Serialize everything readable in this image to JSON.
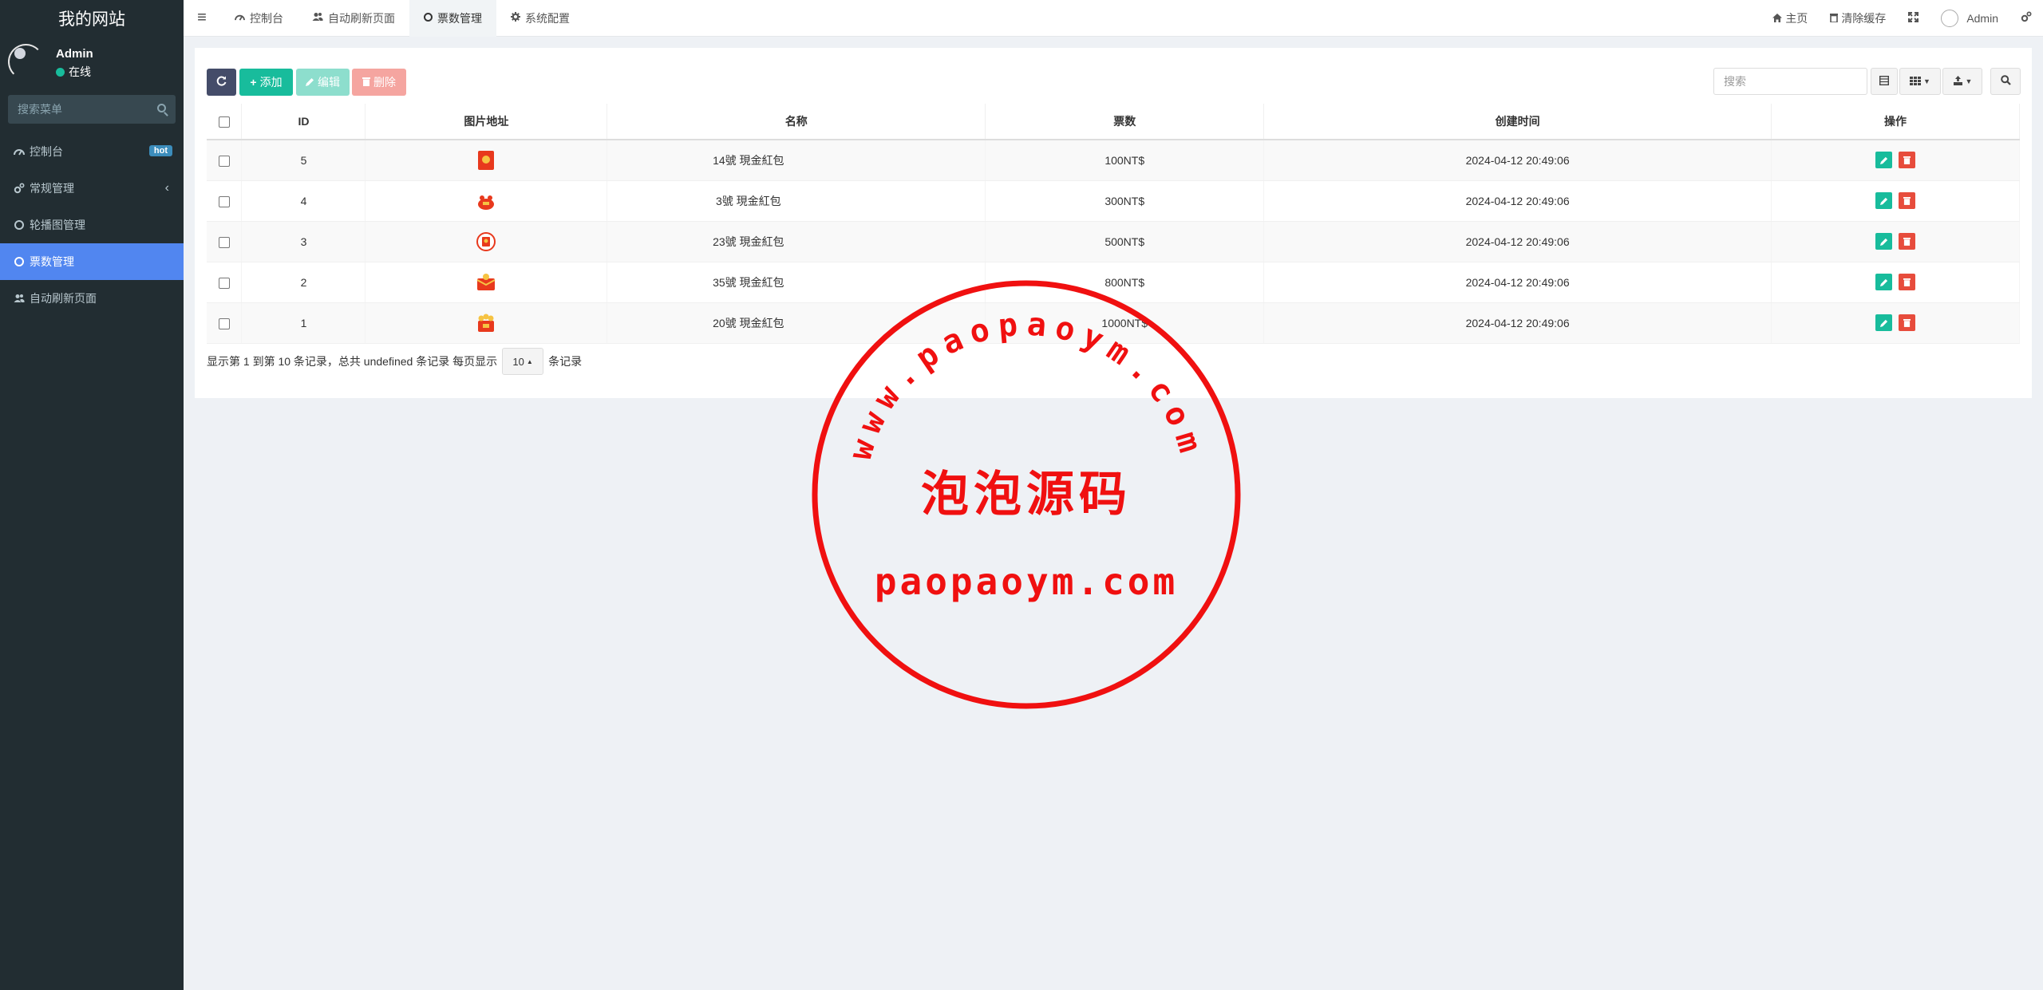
{
  "site": {
    "title": "我的网站"
  },
  "user": {
    "name": "Admin",
    "status": "在线"
  },
  "sidebar": {
    "search_placeholder": "搜索菜单",
    "items": [
      {
        "label": "控制台",
        "icon": "dashboard-icon",
        "badge": "hot"
      },
      {
        "label": "常规管理",
        "icon": "cogs-icon",
        "chevron": "‹"
      },
      {
        "label": "轮播图管理",
        "icon": "circle-icon"
      },
      {
        "label": "票数管理",
        "icon": "circle-icon",
        "active": true
      },
      {
        "label": "自动刷新页面",
        "icon": "users-icon"
      }
    ]
  },
  "header": {
    "menu_glyph": "≡",
    "tabs": [
      {
        "label": "控制台"
      },
      {
        "label": "自动刷新页面"
      },
      {
        "label": "票数管理",
        "active": true
      },
      {
        "label": "系统配置"
      }
    ],
    "right": {
      "home": "主页",
      "clear_cache": "清除缓存",
      "admin": "Admin"
    }
  },
  "toolbar": {
    "add_label": "添加",
    "edit_label": "编辑",
    "delete_label": "删除",
    "search_placeholder": "搜索"
  },
  "table": {
    "columns": [
      "ID",
      "图片地址",
      "名称",
      "票数",
      "创建时间",
      "操作"
    ],
    "rows": [
      {
        "id": "5",
        "name": "14號 現金紅包",
        "votes": "100NT$",
        "created": "2024-04-12 20:49:06"
      },
      {
        "id": "4",
        "name": "3號 現金紅包",
        "votes": "300NT$",
        "created": "2024-04-12 20:49:06"
      },
      {
        "id": "3",
        "name": "23號 現金紅包",
        "votes": "500NT$",
        "created": "2024-04-12 20:49:06"
      },
      {
        "id": "2",
        "name": "35號 現金紅包",
        "votes": "800NT$",
        "created": "2024-04-12 20:49:06"
      },
      {
        "id": "1",
        "name": "20號 現金紅包",
        "votes": "1000NT$",
        "created": "2024-04-12 20:49:06"
      }
    ]
  },
  "pager": {
    "summary": "显示第 1 到第 10 条记录，总共 undefined 条记录 每页显示",
    "page_size": "10",
    "suffix": "条记录"
  },
  "watermark": {
    "arc_text": "www.paopaoym.com",
    "main_text": "泡泡源码",
    "domain_text": "paopaoym.com"
  },
  "colors": {
    "sidebar_bg": "#222d32",
    "active_menu": "#5186f0",
    "success": "#18bc9c",
    "danger": "#e74c3c",
    "stamp_red": "#f01010"
  }
}
